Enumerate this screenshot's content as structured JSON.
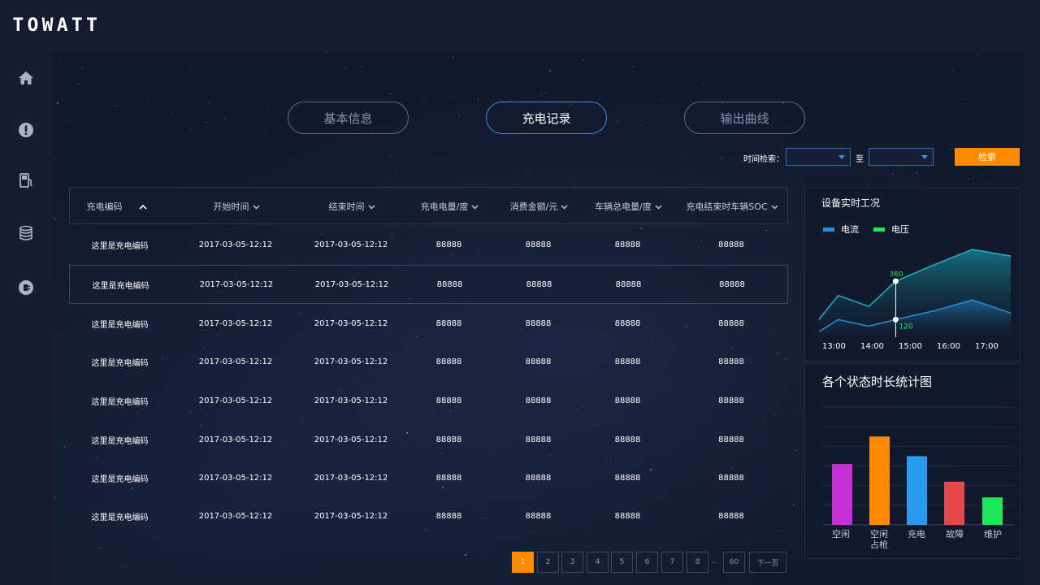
{
  "app": {
    "logo": "TOWATT"
  },
  "sidebar": {
    "icons": [
      "home-icon",
      "alert-icon",
      "fuel-station-icon",
      "database-icon",
      "plug-icon"
    ]
  },
  "tabs": [
    {
      "label": "基本信息",
      "active": false
    },
    {
      "label": "充电记录",
      "active": true
    },
    {
      "label": "输出曲线",
      "active": false
    }
  ],
  "search": {
    "label": "时间检索：",
    "to_label": "至",
    "button_label": "检索",
    "start_value": "",
    "end_value": ""
  },
  "table": {
    "columns": [
      "充电编码",
      "开始时间",
      "结束时间",
      "充电电量/度",
      "消费金额/元",
      "车辆总电量/度",
      "充电结束时车辆SOC"
    ],
    "rows": [
      [
        "这里是充电编码",
        "2017-03-05-12:12",
        "2017-03-05-12:12",
        "88888",
        "88888",
        "88888",
        "88888"
      ],
      [
        "这里是充电编码",
        "2017-03-05-12:12",
        "2017-03-05-12:12",
        "88888",
        "88888",
        "88888",
        "88888"
      ],
      [
        "这里是充电编码",
        "2017-03-05-12:12",
        "2017-03-05-12:12",
        "88888",
        "88888",
        "88888",
        "88888"
      ],
      [
        "这里是充电编码",
        "2017-03-05-12:12",
        "2017-03-05-12:12",
        "88888",
        "88888",
        "88888",
        "88888"
      ],
      [
        "这里是充电编码",
        "2017-03-05-12:12",
        "2017-03-05-12:12",
        "88888",
        "88888",
        "88888",
        "88888"
      ],
      [
        "这里是充电编码",
        "2017-03-05-12:12",
        "2017-03-05-12:12",
        "88888",
        "88888",
        "88888",
        "88888"
      ],
      [
        "这里是充电编码",
        "2017-03-05-12:12",
        "2017-03-05-12:12",
        "88888",
        "88888",
        "88888",
        "88888"
      ],
      [
        "这里是充电编码",
        "2017-03-05-12:12",
        "2017-03-05-12:12",
        "88888",
        "88888",
        "88888",
        "88888"
      ]
    ],
    "selected_row": 1
  },
  "pagination": {
    "pages": [
      "1",
      "2",
      "3",
      "4",
      "5",
      "6",
      "7",
      "8"
    ],
    "ellipsis": "...",
    "last": "60",
    "next_label": "下一页",
    "current": "1"
  },
  "colors": {
    "accent_orange": "#ff8a00",
    "accent_blue": "#2f8fe8",
    "current_line": "#2a8fd8",
    "voltage_line": "#1ee85a"
  },
  "chart_data": [
    {
      "type": "area",
      "title": "设备实时工况",
      "legend": [
        "电流",
        "电压"
      ],
      "legend_position": "top-left",
      "x_ticks": [
        "13:00",
        "14:00",
        "15:00",
        "16:00",
        "17:00"
      ],
      "series": [
        {
          "name": "电流",
          "color": "#1ab5c8",
          "x": [
            0,
            0.5,
            1.3,
            2,
            3,
            4,
            5
          ],
          "y": [
            0.16,
            0.38,
            0.28,
            0.51,
            0.66,
            0.8,
            0.74
          ]
        },
        {
          "name": "电压",
          "color": "#2a8fd8",
          "x": [
            0,
            0.5,
            1.3,
            2,
            3,
            4,
            5
          ],
          "y": [
            0.05,
            0.16,
            0.1,
            0.16,
            0.24,
            0.34,
            0.22
          ]
        }
      ],
      "annotations": [
        {
          "label": "360",
          "color": "#1ee85a"
        },
        {
          "label": "120",
          "color": "#1ee85a"
        }
      ],
      "cursor_x": 2
    },
    {
      "type": "bar",
      "title": "各个状态时长统计图",
      "categories": [
        "空闲",
        "空闲占枪",
        "充电",
        "故障",
        "维护"
      ],
      "category_lines": [
        [
          "空闲"
        ],
        [
          "空闲",
          "占枪"
        ],
        [
          "充电"
        ],
        [
          "故障"
        ],
        [
          "维护"
        ]
      ],
      "values": [
        3.1,
        4.5,
        3.5,
        2.2,
        1.4
      ],
      "colors": [
        "#c432d6",
        "#ff8a00",
        "#2a9af0",
        "#e54848",
        "#1ee85a"
      ],
      "ylim": [
        0,
        6
      ],
      "grid": true
    }
  ]
}
